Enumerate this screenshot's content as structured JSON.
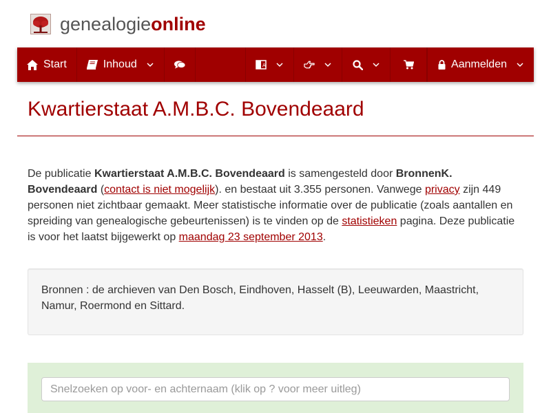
{
  "brand": {
    "name_plain": "genealogie",
    "name_accent": "online",
    "accent_color": "#a00000",
    "logo_icon": "tree-icon"
  },
  "nav": {
    "items": [
      {
        "label": "Start",
        "icon": "home-icon",
        "has_dropdown": false
      },
      {
        "label": "Inhoud",
        "icon": "book-icon",
        "has_dropdown": true
      },
      {
        "label": "",
        "icon": "comments-icon",
        "has_dropdown": false
      },
      {
        "label": "",
        "icon": "language-icon",
        "has_dropdown": true
      },
      {
        "label": "",
        "icon": "hand-point-right-icon",
        "has_dropdown": true
      },
      {
        "label": "",
        "icon": "search-icon",
        "has_dropdown": true
      },
      {
        "label": "",
        "icon": "cart-icon",
        "has_dropdown": false
      },
      {
        "label": "Aanmelden",
        "icon": "lock-icon",
        "has_dropdown": true
      }
    ]
  },
  "page": {
    "title": "Kwartierstaat A.M.B.C. Bovendeaard"
  },
  "intro": {
    "t1": "De publicatie ",
    "pub_name": "Kwartierstaat A.M.B.C. Bovendeaard",
    "t2": " is samengesteld door ",
    "author": "BronnenK. Bovendeaard",
    "t3": " (",
    "contact_link": "contact is niet mogelijk",
    "t4": "). en bestaat uit 3.355 personen. Vanwege ",
    "privacy_link": "privacy",
    "t5": " zijn 449 personen niet zichtbaar gemaakt. Meer statistische informatie over de publicatie (zoals aantallen en spreiding van genealogische gebeurtenissen) is te vinden op de ",
    "stats_link": "statistieken",
    "t6": " pagina. Deze publicatie is voor het laatst bijgewerkt op ",
    "date_link": "maandag 23 september 2013",
    "t7": "."
  },
  "sources": {
    "text": "Bronnen : de archieven van Den Bosch, Eindhoven, Hasselt (B), Leeuwarden, Maastricht, Namur, Roermond en Sittard."
  },
  "search": {
    "placeholder": "Snelzoeken op voor- en achternaam (klik op ? voor meer uitleg)",
    "value": "",
    "panel_color": "#dff0d8"
  }
}
